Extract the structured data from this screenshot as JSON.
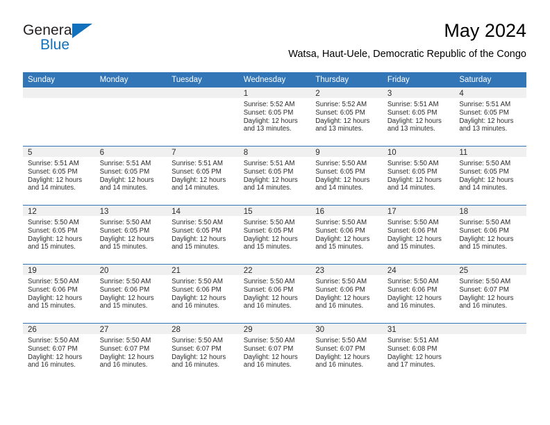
{
  "logo": {
    "word_one": "General",
    "word_two": "Blue",
    "triangle_icon": "blue-triangle-icon",
    "brand_color": "#1271bd"
  },
  "header": {
    "title": "May 2024",
    "subtitle": "Watsa, Haut-Uele, Democratic Republic of the Congo"
  },
  "theme": {
    "header_blue": "#3276b8",
    "daynum_band": "#f0f0f0",
    "text": "#2b2b2b"
  },
  "calendar": {
    "weekday_headers": [
      "Sunday",
      "Monday",
      "Tuesday",
      "Wednesday",
      "Thursday",
      "Friday",
      "Saturday"
    ],
    "weeks": [
      [
        {
          "day": "",
          "empty": true,
          "sunrise": "",
          "sunset": "",
          "daylight_line1": "",
          "daylight_line2": ""
        },
        {
          "day": "",
          "empty": true,
          "sunrise": "",
          "sunset": "",
          "daylight_line1": "",
          "daylight_line2": ""
        },
        {
          "day": "",
          "empty": true,
          "sunrise": "",
          "sunset": "",
          "daylight_line1": "",
          "daylight_line2": ""
        },
        {
          "day": "1",
          "empty": false,
          "sunrise": "Sunrise: 5:52 AM",
          "sunset": "Sunset: 6:05 PM",
          "daylight_line1": "Daylight: 12 hours",
          "daylight_line2": "and 13 minutes."
        },
        {
          "day": "2",
          "empty": false,
          "sunrise": "Sunrise: 5:52 AM",
          "sunset": "Sunset: 6:05 PM",
          "daylight_line1": "Daylight: 12 hours",
          "daylight_line2": "and 13 minutes."
        },
        {
          "day": "3",
          "empty": false,
          "sunrise": "Sunrise: 5:51 AM",
          "sunset": "Sunset: 6:05 PM",
          "daylight_line1": "Daylight: 12 hours",
          "daylight_line2": "and 13 minutes."
        },
        {
          "day": "4",
          "empty": false,
          "sunrise": "Sunrise: 5:51 AM",
          "sunset": "Sunset: 6:05 PM",
          "daylight_line1": "Daylight: 12 hours",
          "daylight_line2": "and 13 minutes."
        }
      ],
      [
        {
          "day": "5",
          "empty": false,
          "sunrise": "Sunrise: 5:51 AM",
          "sunset": "Sunset: 6:05 PM",
          "daylight_line1": "Daylight: 12 hours",
          "daylight_line2": "and 14 minutes."
        },
        {
          "day": "6",
          "empty": false,
          "sunrise": "Sunrise: 5:51 AM",
          "sunset": "Sunset: 6:05 PM",
          "daylight_line1": "Daylight: 12 hours",
          "daylight_line2": "and 14 minutes."
        },
        {
          "day": "7",
          "empty": false,
          "sunrise": "Sunrise: 5:51 AM",
          "sunset": "Sunset: 6:05 PM",
          "daylight_line1": "Daylight: 12 hours",
          "daylight_line2": "and 14 minutes."
        },
        {
          "day": "8",
          "empty": false,
          "sunrise": "Sunrise: 5:51 AM",
          "sunset": "Sunset: 6:05 PM",
          "daylight_line1": "Daylight: 12 hours",
          "daylight_line2": "and 14 minutes."
        },
        {
          "day": "9",
          "empty": false,
          "sunrise": "Sunrise: 5:50 AM",
          "sunset": "Sunset: 6:05 PM",
          "daylight_line1": "Daylight: 12 hours",
          "daylight_line2": "and 14 minutes."
        },
        {
          "day": "10",
          "empty": false,
          "sunrise": "Sunrise: 5:50 AM",
          "sunset": "Sunset: 6:05 PM",
          "daylight_line1": "Daylight: 12 hours",
          "daylight_line2": "and 14 minutes."
        },
        {
          "day": "11",
          "empty": false,
          "sunrise": "Sunrise: 5:50 AM",
          "sunset": "Sunset: 6:05 PM",
          "daylight_line1": "Daylight: 12 hours",
          "daylight_line2": "and 14 minutes."
        }
      ],
      [
        {
          "day": "12",
          "empty": false,
          "sunrise": "Sunrise: 5:50 AM",
          "sunset": "Sunset: 6:05 PM",
          "daylight_line1": "Daylight: 12 hours",
          "daylight_line2": "and 15 minutes."
        },
        {
          "day": "13",
          "empty": false,
          "sunrise": "Sunrise: 5:50 AM",
          "sunset": "Sunset: 6:05 PM",
          "daylight_line1": "Daylight: 12 hours",
          "daylight_line2": "and 15 minutes."
        },
        {
          "day": "14",
          "empty": false,
          "sunrise": "Sunrise: 5:50 AM",
          "sunset": "Sunset: 6:05 PM",
          "daylight_line1": "Daylight: 12 hours",
          "daylight_line2": "and 15 minutes."
        },
        {
          "day": "15",
          "empty": false,
          "sunrise": "Sunrise: 5:50 AM",
          "sunset": "Sunset: 6:05 PM",
          "daylight_line1": "Daylight: 12 hours",
          "daylight_line2": "and 15 minutes."
        },
        {
          "day": "16",
          "empty": false,
          "sunrise": "Sunrise: 5:50 AM",
          "sunset": "Sunset: 6:06 PM",
          "daylight_line1": "Daylight: 12 hours",
          "daylight_line2": "and 15 minutes."
        },
        {
          "day": "17",
          "empty": false,
          "sunrise": "Sunrise: 5:50 AM",
          "sunset": "Sunset: 6:06 PM",
          "daylight_line1": "Daylight: 12 hours",
          "daylight_line2": "and 15 minutes."
        },
        {
          "day": "18",
          "empty": false,
          "sunrise": "Sunrise: 5:50 AM",
          "sunset": "Sunset: 6:06 PM",
          "daylight_line1": "Daylight: 12 hours",
          "daylight_line2": "and 15 minutes."
        }
      ],
      [
        {
          "day": "19",
          "empty": false,
          "sunrise": "Sunrise: 5:50 AM",
          "sunset": "Sunset: 6:06 PM",
          "daylight_line1": "Daylight: 12 hours",
          "daylight_line2": "and 15 minutes."
        },
        {
          "day": "20",
          "empty": false,
          "sunrise": "Sunrise: 5:50 AM",
          "sunset": "Sunset: 6:06 PM",
          "daylight_line1": "Daylight: 12 hours",
          "daylight_line2": "and 15 minutes."
        },
        {
          "day": "21",
          "empty": false,
          "sunrise": "Sunrise: 5:50 AM",
          "sunset": "Sunset: 6:06 PM",
          "daylight_line1": "Daylight: 12 hours",
          "daylight_line2": "and 16 minutes."
        },
        {
          "day": "22",
          "empty": false,
          "sunrise": "Sunrise: 5:50 AM",
          "sunset": "Sunset: 6:06 PM",
          "daylight_line1": "Daylight: 12 hours",
          "daylight_line2": "and 16 minutes."
        },
        {
          "day": "23",
          "empty": false,
          "sunrise": "Sunrise: 5:50 AM",
          "sunset": "Sunset: 6:06 PM",
          "daylight_line1": "Daylight: 12 hours",
          "daylight_line2": "and 16 minutes."
        },
        {
          "day": "24",
          "empty": false,
          "sunrise": "Sunrise: 5:50 AM",
          "sunset": "Sunset: 6:06 PM",
          "daylight_line1": "Daylight: 12 hours",
          "daylight_line2": "and 16 minutes."
        },
        {
          "day": "25",
          "empty": false,
          "sunrise": "Sunrise: 5:50 AM",
          "sunset": "Sunset: 6:07 PM",
          "daylight_line1": "Daylight: 12 hours",
          "daylight_line2": "and 16 minutes."
        }
      ],
      [
        {
          "day": "26",
          "empty": false,
          "sunrise": "Sunrise: 5:50 AM",
          "sunset": "Sunset: 6:07 PM",
          "daylight_line1": "Daylight: 12 hours",
          "daylight_line2": "and 16 minutes."
        },
        {
          "day": "27",
          "empty": false,
          "sunrise": "Sunrise: 5:50 AM",
          "sunset": "Sunset: 6:07 PM",
          "daylight_line1": "Daylight: 12 hours",
          "daylight_line2": "and 16 minutes."
        },
        {
          "day": "28",
          "empty": false,
          "sunrise": "Sunrise: 5:50 AM",
          "sunset": "Sunset: 6:07 PM",
          "daylight_line1": "Daylight: 12 hours",
          "daylight_line2": "and 16 minutes."
        },
        {
          "day": "29",
          "empty": false,
          "sunrise": "Sunrise: 5:50 AM",
          "sunset": "Sunset: 6:07 PM",
          "daylight_line1": "Daylight: 12 hours",
          "daylight_line2": "and 16 minutes."
        },
        {
          "day": "30",
          "empty": false,
          "sunrise": "Sunrise: 5:50 AM",
          "sunset": "Sunset: 6:07 PM",
          "daylight_line1": "Daylight: 12 hours",
          "daylight_line2": "and 16 minutes."
        },
        {
          "day": "31",
          "empty": false,
          "sunrise": "Sunrise: 5:51 AM",
          "sunset": "Sunset: 6:08 PM",
          "daylight_line1": "Daylight: 12 hours",
          "daylight_line2": "and 17 minutes."
        },
        {
          "day": "",
          "empty": true,
          "sunrise": "",
          "sunset": "",
          "daylight_line1": "",
          "daylight_line2": ""
        }
      ]
    ]
  }
}
